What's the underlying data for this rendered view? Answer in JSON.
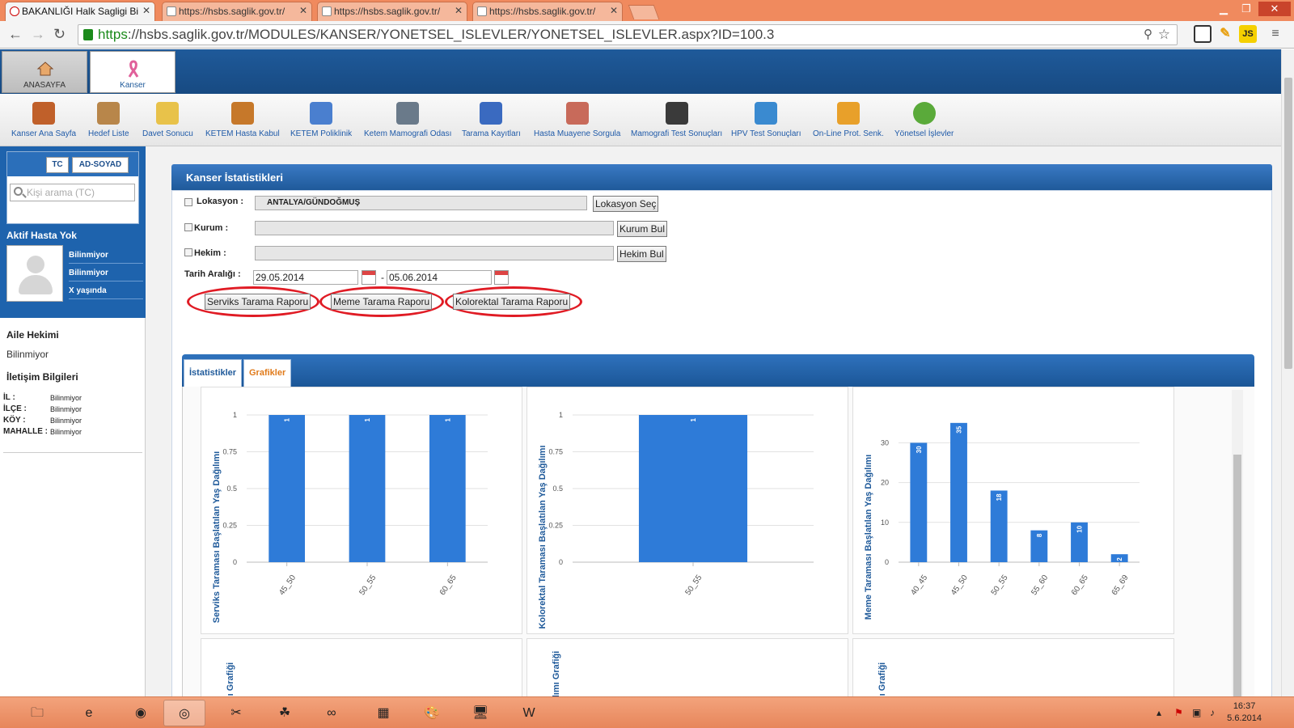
{
  "browser": {
    "tabs": [
      {
        "title": "BAKANLIĞI Halk Sagligi Bi",
        "active": true
      },
      {
        "title": "https://hsbs.saglik.gov.tr/",
        "active": false
      },
      {
        "title": "https://hsbs.saglik.gov.tr/",
        "active": false
      },
      {
        "title": "https://hsbs.saglik.gov.tr/",
        "active": false
      }
    ],
    "close_glyph": "✕",
    "url_scheme": "https",
    "url_rest": "://hsbs.saglik.gov.tr/MODULES/KANSER/YONETSEL_ISLEVLER/YONETSEL_ISLEVLER.aspx?ID=100.3",
    "ext_js": "JS"
  },
  "app": {
    "top_tabs": [
      {
        "label": "ANASAYFA",
        "icon": "home-icon"
      },
      {
        "label": "Kanser",
        "icon": "ribbon-icon"
      }
    ],
    "toolbar": [
      {
        "label": "Kanser Ana Sayfa",
        "icon": "home-icon",
        "color": "#c0602a"
      },
      {
        "label": "Hedef Liste",
        "icon": "clipboard-icon",
        "color": "#b8864a"
      },
      {
        "label": "Davet Sonucu",
        "icon": "envelope-icon",
        "color": "#e8c24a"
      },
      {
        "label": "KETEM Hasta Kabul",
        "icon": "patient-add-icon",
        "color": "#c6782a"
      },
      {
        "label": "KETEM Poliklinik",
        "icon": "stethoscope-icon",
        "color": "#4a7fcf"
      },
      {
        "label": "Ketem Mamografi Odası",
        "icon": "xray-room-icon",
        "color": "#6a7a8a"
      },
      {
        "label": "Tarama Kayıtları",
        "icon": "records-icon",
        "color": "#3a6ac0"
      },
      {
        "label": "Hasta Muayene Sorgula",
        "icon": "doctor-search-icon",
        "color": "#c86a5a"
      },
      {
        "label": "Mamografi Test Sonuçları",
        "icon": "xray-icon",
        "color": "#3a3a3a"
      },
      {
        "label": "HPV Test Sonuçları",
        "icon": "flask-icon",
        "color": "#3a8ad0"
      },
      {
        "label": "On-Line Prot. Senk.",
        "icon": "sync-arrows-icon",
        "color": "#e8a02a"
      },
      {
        "label": "Yönetsel İşlevler",
        "icon": "pie-chart-icon",
        "color": "#5aaa3a"
      }
    ]
  },
  "left": {
    "tab_tc": "TC",
    "tab_adsoyad": "AD-SOYAD",
    "search_placeholder": "Kişi arama (TC)",
    "active_patient": "Aktif Hasta Yok",
    "patient_info": [
      "Bilinmiyor",
      "Bilinmiyor",
      "X yaşında"
    ],
    "family_doctor_label": "Aile Hekimi",
    "family_doctor_value": "Bilinmiyor",
    "contact_label": "İletişim Bilgileri",
    "address": [
      {
        "key": "İL :",
        "value": "Bilinmiyor"
      },
      {
        "key": "İLÇE :",
        "value": "Bilinmiyor"
      },
      {
        "key": "KÖY :",
        "value": "Bilinmiyor"
      },
      {
        "key": "MAHALLE :",
        "value": "Bilinmiyor"
      }
    ]
  },
  "main": {
    "header": "Kanser İstatistikleri",
    "location_label": "Lokasyon :",
    "location_value": "ANTALYA/GÜNDOĞMUŞ",
    "location_btn": "Lokasyon Seç",
    "kurum_label": "Kurum :",
    "kurum_btn": "Kurum Bul",
    "hekim_label": "Hekim :",
    "hekim_btn": "Hekim Bul",
    "date_label": "Tarih Aralığı :",
    "date_from": "29.05.2014",
    "date_sep": "-",
    "date_to": "05.06.2014",
    "report_buttons": [
      "Serviks Tarama Raporu",
      "Meme Tarama Raporu",
      "Kolorektal Tarama Raporu"
    ],
    "highlight_color": "#e01b24",
    "tabs": [
      {
        "label": "İstatistikler",
        "color": "#1f5a9a"
      },
      {
        "label": "Grafikler",
        "color": "#e07a1a"
      }
    ],
    "partial_chart_labels": [
      "ğılımı Grafiği",
      "Dağılımı Grafiği",
      "ğılımı Grafiği"
    ]
  },
  "chart_data": [
    {
      "type": "bar",
      "ylabel": "Serviks Taraması Başlatılan Yaş Dağılımı",
      "categories": [
        "45_50",
        "50_55",
        "60_65"
      ],
      "values": [
        1,
        1,
        1
      ],
      "ylim": [
        0,
        1
      ],
      "yticks": [
        0,
        0.25,
        0.5,
        0.75,
        1
      ],
      "bar_color": "#2e7bd8",
      "grid": true
    },
    {
      "type": "bar",
      "ylabel": "Kolorektal Taraması Başlatılan Yaş Dağılımı",
      "categories": [
        "50_55"
      ],
      "values": [
        1
      ],
      "ylim": [
        0,
        1
      ],
      "yticks": [
        0,
        0.25,
        0.5,
        0.75,
        1
      ],
      "bar_color": "#2e7bd8",
      "grid": true
    },
    {
      "type": "bar",
      "ylabel": "Meme Taraması Başlatılan Yaş Dağılımı",
      "categories": [
        "40_45",
        "45_50",
        "50_55",
        "55_60",
        "60_65",
        "65_69"
      ],
      "values": [
        30,
        35,
        18,
        8,
        10,
        2
      ],
      "ylim": [
        0,
        37
      ],
      "yticks": [
        0,
        10,
        20,
        30
      ],
      "bar_color": "#2e7bd8",
      "grid": true
    }
  ],
  "taskbar": {
    "apps": [
      {
        "name": "file-explorer-icon",
        "glyph": "🗀"
      },
      {
        "name": "internet-explorer-icon",
        "glyph": "e"
      },
      {
        "name": "firefox-icon",
        "glyph": "◉"
      },
      {
        "name": "chrome-icon",
        "glyph": "◎",
        "active": true
      },
      {
        "name": "tools-icon",
        "glyph": "✂"
      },
      {
        "name": "frog-icon",
        "glyph": "☘"
      },
      {
        "name": "visual-studio-icon",
        "glyph": "∞"
      },
      {
        "name": "chart-app-icon",
        "glyph": "▦"
      },
      {
        "name": "paint-icon",
        "glyph": "🎨"
      },
      {
        "name": "remote-desktop-icon",
        "glyph": "🖥"
      },
      {
        "name": "word-icon",
        "glyph": "W"
      }
    ],
    "time": "16:37",
    "date": "5.6.2014"
  }
}
